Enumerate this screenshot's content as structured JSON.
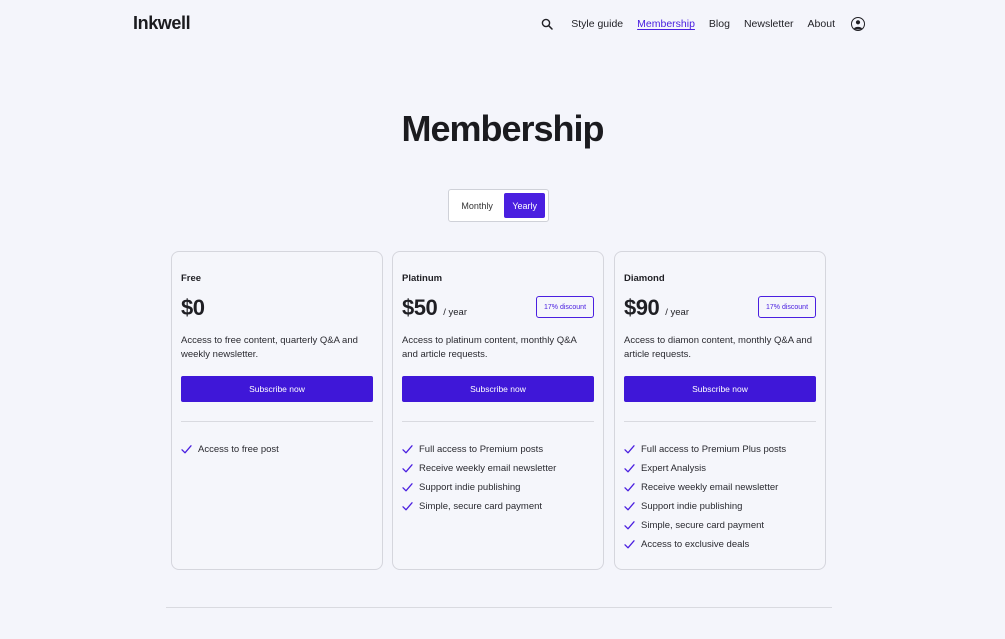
{
  "header": {
    "logo": "Inkwell",
    "nav": {
      "style_guide": "Style guide",
      "membership": "Membership",
      "blog": "Blog",
      "newsletter": "Newsletter",
      "about": "About"
    },
    "icons": {
      "search": "search-icon",
      "account": "user-icon"
    }
  },
  "page": {
    "title": "Membership"
  },
  "billing_toggle": {
    "monthly": "Monthly",
    "yearly": "Yearly",
    "selected": "Yearly"
  },
  "colors": {
    "accent": "#4a1fe0",
    "background": "#f4f5fb"
  },
  "plans": [
    {
      "name": "Free",
      "price": "$0",
      "period": "",
      "discount": "",
      "description": "Access to free content, quarterly Q&A and weekly newsletter.",
      "cta": "Subscribe now",
      "features": [
        "Access to free post"
      ]
    },
    {
      "name": "Platinum",
      "price": "$50",
      "period": "/ year",
      "discount": "17% discount",
      "description": "Access to platinum content, monthly Q&A and article requests.",
      "cta": "Subscribe now",
      "features": [
        "Full access to Premium posts",
        "Receive weekly email newsletter",
        "Support indie publishing",
        "Simple, secure card payment"
      ]
    },
    {
      "name": "Diamond",
      "price": "$90",
      "period": "/ year",
      "discount": "17% discount",
      "description": "Access to diamon content, monthly Q&A and article requests.",
      "cta": "Subscribe now",
      "features": [
        "Full access to Premium Plus posts",
        "Expert Analysis",
        "Receive weekly email newsletter",
        "Support indie publishing",
        "Simple, secure card payment",
        "Access to exclusive deals"
      ]
    }
  ]
}
